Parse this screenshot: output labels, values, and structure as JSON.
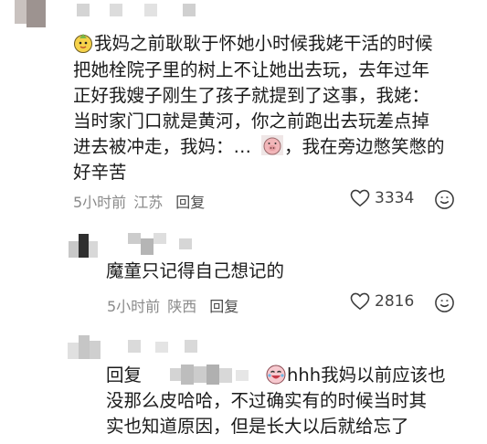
{
  "comments": [
    {
      "lines": [
        "我妈之前耿耿于怀她小时候我姥干活的时候",
        "把她栓院子里的树上不让她出去玩，去年过年",
        "正好我嫂子刚生了孩子就提到了这事，我姥：",
        "当时家门口就是黄河，你之前跑出去玩差点掉",
        "进去被冲走，我妈：…",
        "，我在旁边憋笑憋的",
        "好辛苦"
      ],
      "time": "5小时前",
      "location": "江苏",
      "reply_label": "回复",
      "likes": "3334"
    },
    {
      "lines": [
        "魔童只记得自己想记的"
      ],
      "time": "5小时前",
      "location": "陕西",
      "reply_label": "回复",
      "likes": "2816"
    },
    {
      "reply_prefix": "回复",
      "lines": [
        "hhh我妈以前应该也",
        "没那么皮哈哈，不过确实有的时候当时其",
        "实也知道原因，但是长大以后就给忘了"
      ]
    }
  ]
}
